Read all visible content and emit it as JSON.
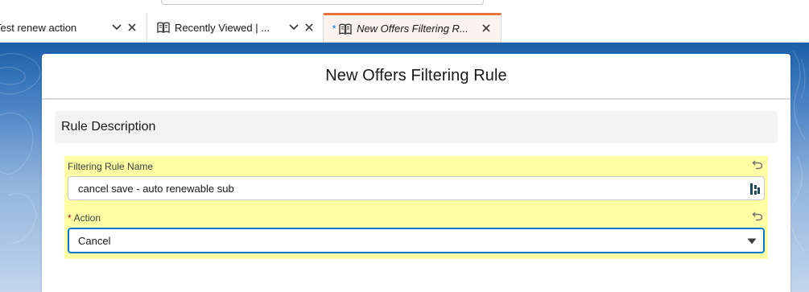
{
  "tabs": [
    {
      "label": "Test renew action",
      "has_menu": true,
      "icon": "",
      "active": false
    },
    {
      "label": "Recently Viewed | ...",
      "has_menu": true,
      "icon": "object-book-icon",
      "active": false
    },
    {
      "label": "New Offers Filtering R...",
      "has_menu": false,
      "icon": "object-book-icon",
      "active": true,
      "dirty_mark": "*"
    }
  ],
  "modal": {
    "title": "New Offers Filtering Rule",
    "section": {
      "title": "Rule Description"
    },
    "fields": {
      "rule_name": {
        "label": "Filtering Rule Name",
        "value": "cancel save - auto renewable sub"
      },
      "action": {
        "label": "Action",
        "required_mark": "*",
        "value": "Cancel"
      }
    }
  },
  "colors": {
    "accent": "#0176d3",
    "active_tab_border": "#e8743b",
    "changed_field_highlight": "#ffffa6",
    "required": "#ba0517"
  }
}
